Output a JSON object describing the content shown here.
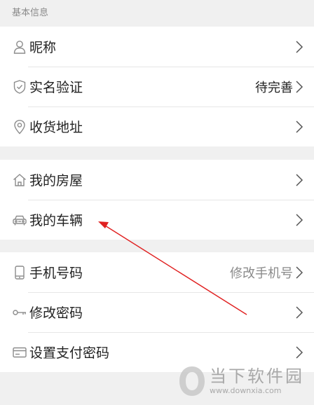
{
  "section": {
    "header": "基本信息"
  },
  "groups": [
    {
      "items": [
        {
          "label": "昵称",
          "value": "",
          "icon": "person-icon"
        },
        {
          "label": "实名验证",
          "value": "待完善",
          "icon": "shield-check-icon"
        },
        {
          "label": "收货地址",
          "value": "",
          "icon": "location-pin-icon"
        }
      ]
    },
    {
      "items": [
        {
          "label": "我的房屋",
          "value": "",
          "icon": "house-icon"
        },
        {
          "label": "我的车辆",
          "value": "",
          "icon": "car-icon"
        }
      ]
    },
    {
      "items": [
        {
          "label": "手机号码",
          "value": "修改手机号",
          "icon": "phone-icon"
        },
        {
          "label": "修改密码",
          "value": "",
          "icon": "key-icon"
        },
        {
          "label": "设置支付密码",
          "value": "",
          "icon": "card-icon"
        }
      ]
    }
  ],
  "annotation": {
    "color": "#e02020"
  },
  "watermark": {
    "title": "当下软件园",
    "url": "www.downxia.com"
  },
  "colors": {
    "background": "#f0f0f0",
    "card": "#ffffff",
    "text": "#222222",
    "muted": "#8a8a8a",
    "icon": "#8c8c8c"
  }
}
